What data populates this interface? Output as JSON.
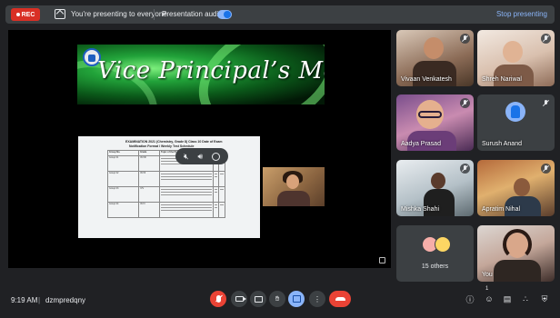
{
  "topbar": {
    "rec_label": "REC",
    "present_notice": "You're presenting to everyone",
    "audio_label": "Presentation audio",
    "audio_on": true,
    "stop_label": "Stop presenting"
  },
  "stage": {
    "banner_title": "Vice Principal’s Message",
    "document": {
      "heading_1": "EXAMINATION 2021 (Chemistry, Grade 8) Class 10 Date of Exam",
      "heading_2": "Notification Format / Weekly Test Schedule",
      "columns": [
        "Group No.",
        "Grade",
        "Topic of the Project",
        "",
        ""
      ],
      "rows": [
        [
          "Group 01",
          "IX/VIII",
          "",
          "",
          ""
        ],
        [
          "Group 02",
          "IX/VII",
          "",
          "",
          ""
        ],
        [
          "Group 03",
          "X/V",
          "",
          "",
          ""
        ],
        [
          "Group 04",
          "IX/VI",
          "",
          "",
          ""
        ]
      ]
    }
  },
  "participants": [
    {
      "name": "Vivaan Venkatesh",
      "muted": true
    },
    {
      "name": "Shreh Nariwal",
      "muted": true
    },
    {
      "name": "Aadya Prasad",
      "muted": true
    },
    {
      "name": "Surush Anand",
      "muted": true
    },
    {
      "name": "Mishka Shahi",
      "muted": true
    },
    {
      "name": "Apratim Nihal",
      "muted": true
    }
  ],
  "others": {
    "label": "15 others"
  },
  "self_tile": {
    "name": "You"
  },
  "bottombar": {
    "time": "9:19 AM",
    "separator": "|",
    "meeting_code": "dzmpredqny",
    "people_count": "1"
  },
  "colors": {
    "accent": "#8ab4f8",
    "danger": "#ea4335",
    "surface": "#3c4043",
    "background": "#202124"
  }
}
